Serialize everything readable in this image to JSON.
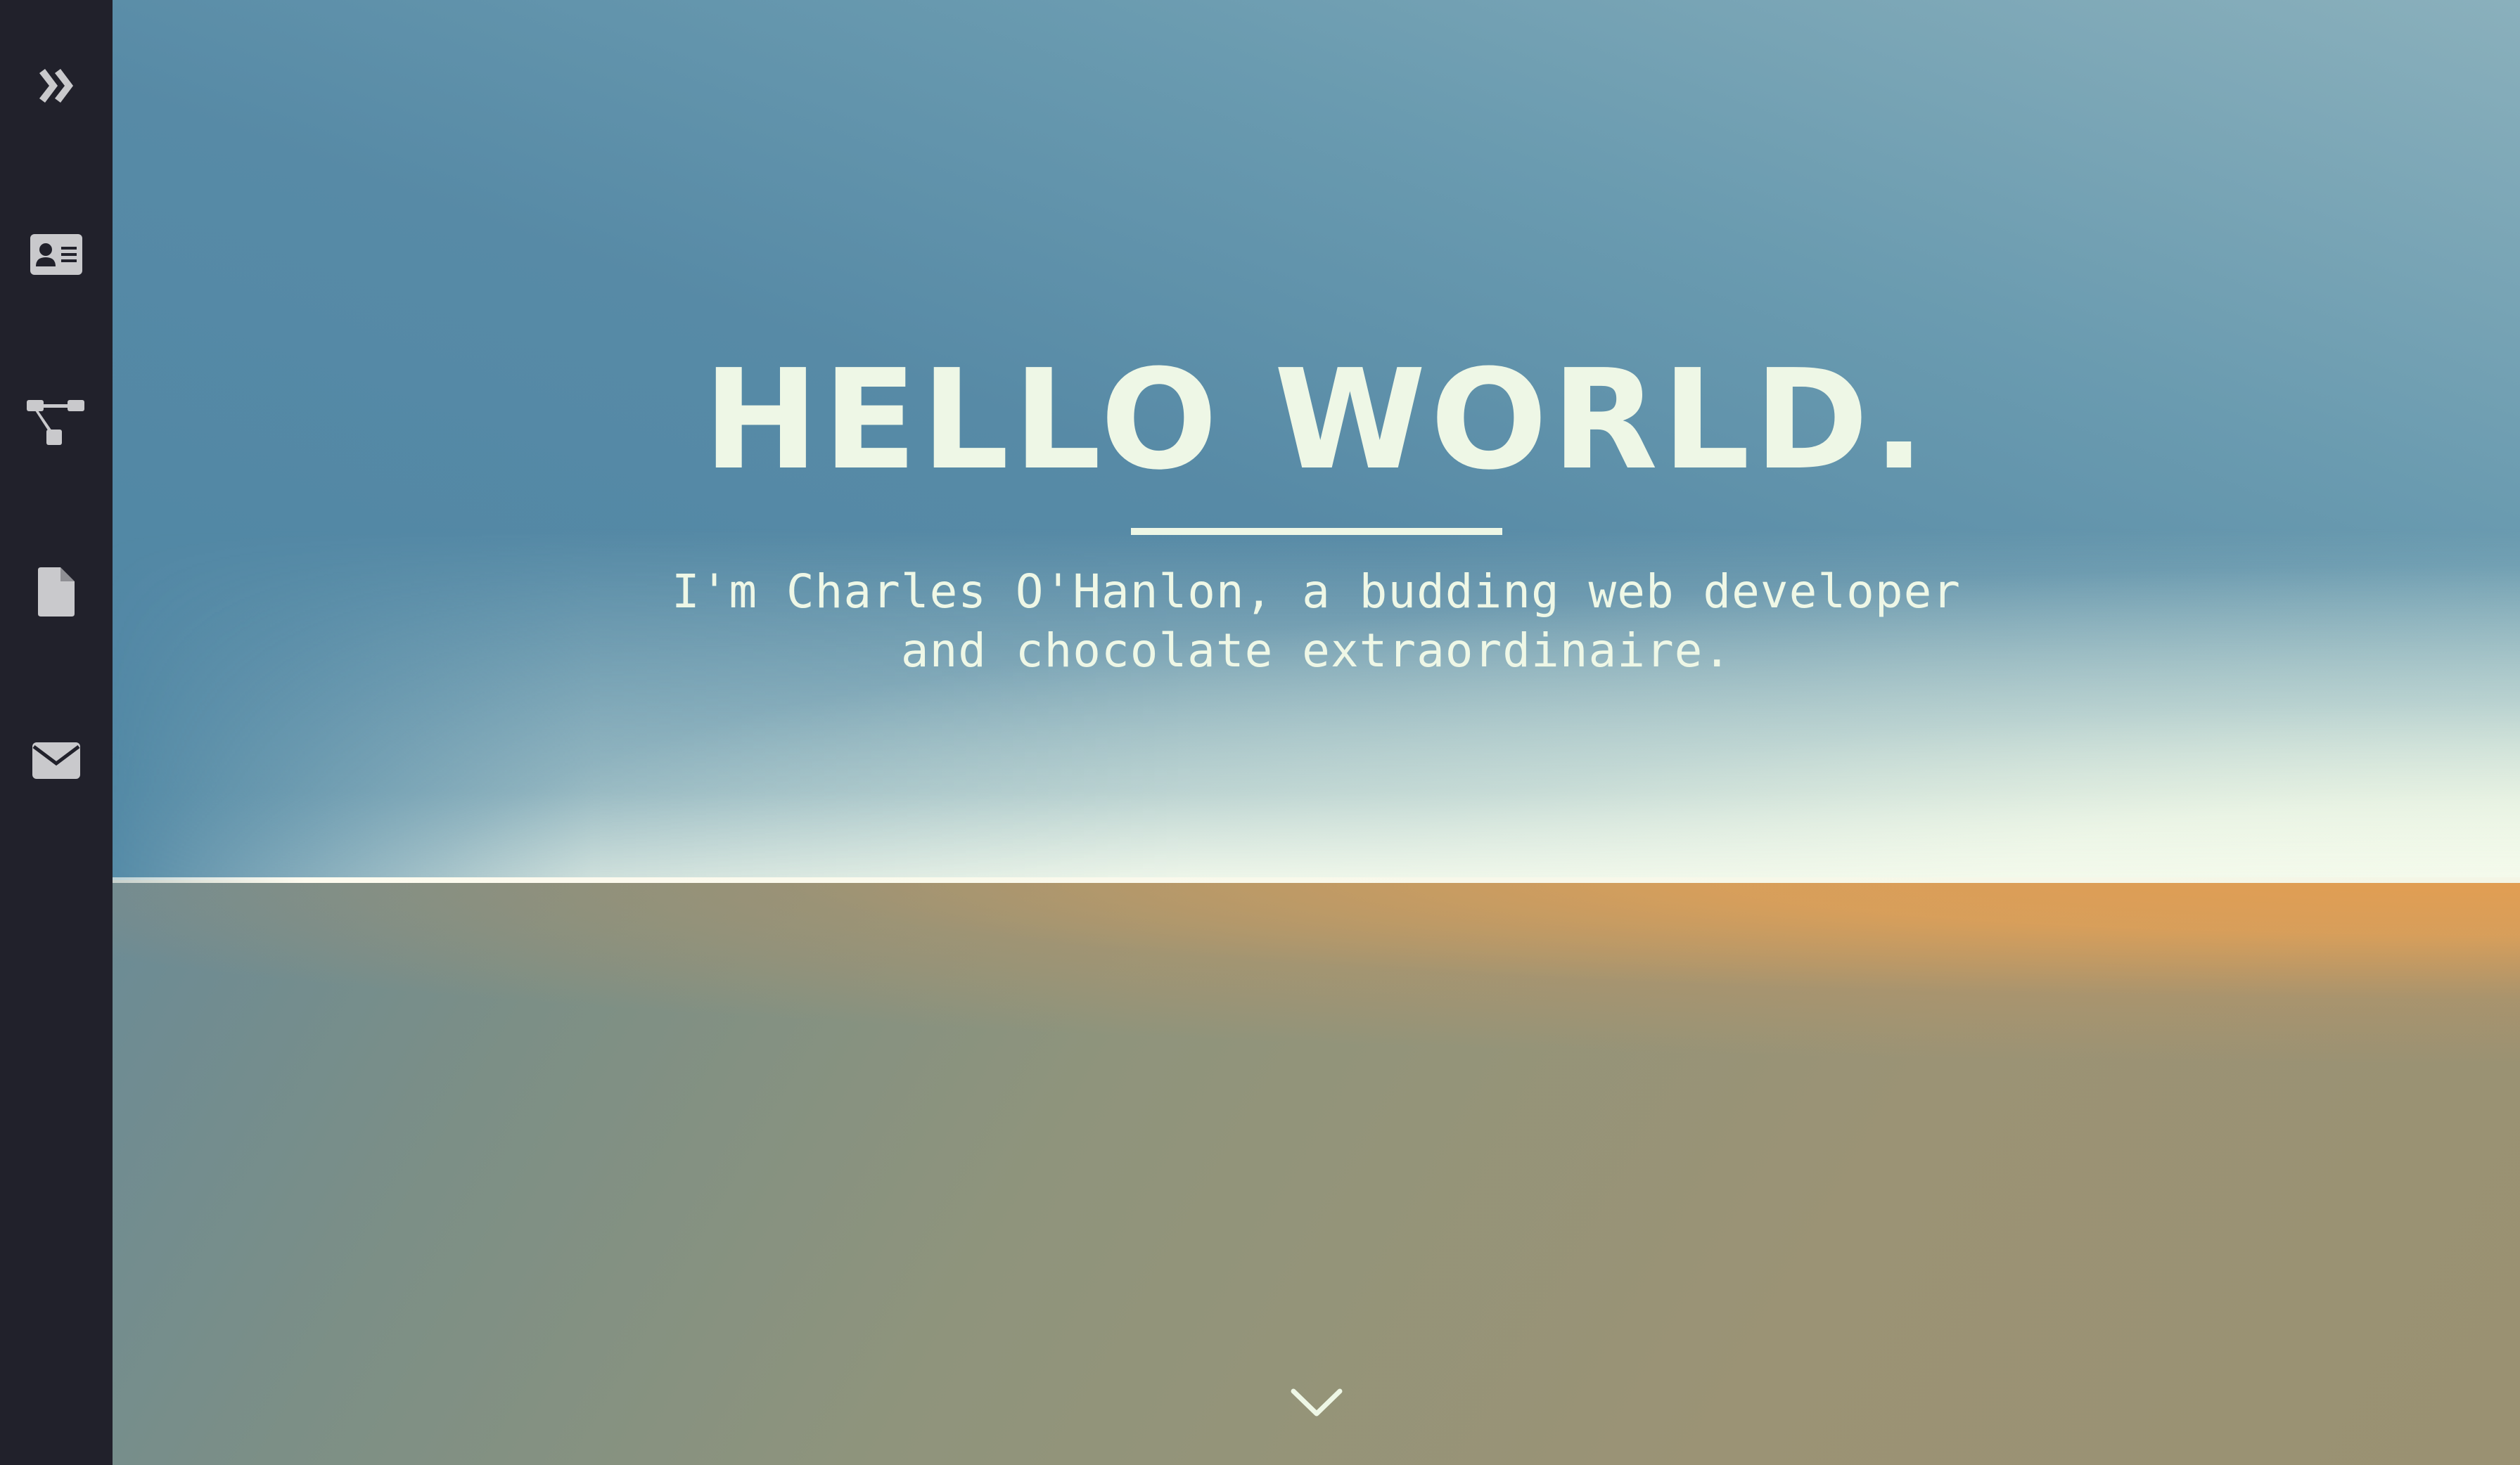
{
  "sidebar": {
    "items": [
      {
        "icon": "double-chevron-right-icon"
      },
      {
        "icon": "contact-card-icon"
      },
      {
        "icon": "sitemap-icon"
      },
      {
        "icon": "file-icon"
      },
      {
        "icon": "envelope-icon"
      }
    ]
  },
  "hero": {
    "title": "HELLO WORLD.",
    "tagline_line1": "I'm Charles O'Hanlon, a budding web developer",
    "tagline_line2": "and chocolate extraordinaire.",
    "scroll_icon": "chevron-down-icon"
  },
  "colors": {
    "sidebar": "#21212b",
    "sky_top": "#4e86a4",
    "horizon_light": "#eef7e6",
    "ground_orange": "#e09f55",
    "ground_olive": "#9a9172",
    "text": "#eef7e6"
  }
}
